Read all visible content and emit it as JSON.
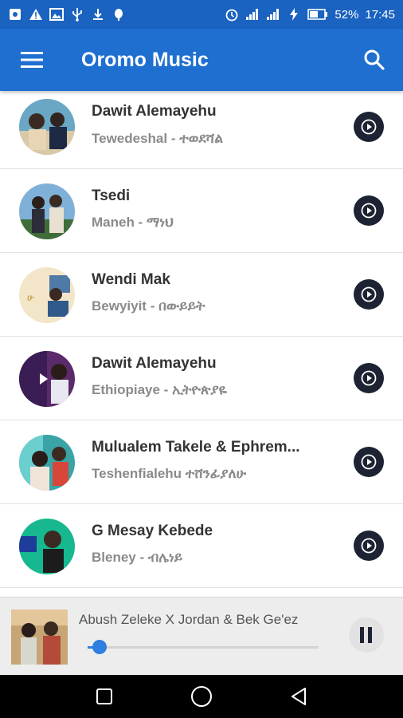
{
  "status_bar": {
    "battery": "52%",
    "time": "17:45",
    "icons": [
      "notification-icon",
      "warning-icon",
      "image-icon",
      "usb-icon",
      "download-icon",
      "android-debug-icon",
      "alarm-icon",
      "signal-icon",
      "signal-icon",
      "charging-icon",
      "battery-icon"
    ]
  },
  "app_bar": {
    "title": "Oromo Music",
    "menu_icon": "menu-icon",
    "search_icon": "search-icon"
  },
  "songs": [
    {
      "artist": "Dawit Alemayehu",
      "title": "Tewedeshal  - ተወደሻል"
    },
    {
      "artist": "Tsedi",
      "title": "Maneh - ማነህ"
    },
    {
      "artist": "Wendi Mak",
      "title": "Bewyiyit - በውይይት"
    },
    {
      "artist": "Dawit Alemayehu",
      "title": "Ethiopiaye - ኢትዮጵያዬ"
    },
    {
      "artist": "Mulualem Takele & Ephrem...",
      "title": "Teshenfialehu  ተሸንፊያለሁ"
    },
    {
      "artist": "G Mesay Kebede",
      "title": "Bleney - ብሌነይ"
    }
  ],
  "player": {
    "track": "Abush Zeleke X Jordan & Bek Ge'ez",
    "progress": 0.05,
    "pause_icon": "pause-icon"
  },
  "colors": {
    "app_bar": "#1f6fd1",
    "status_bar": "#1a63c0",
    "accent": "#2f7fe0",
    "play_button": "#1e2333"
  }
}
